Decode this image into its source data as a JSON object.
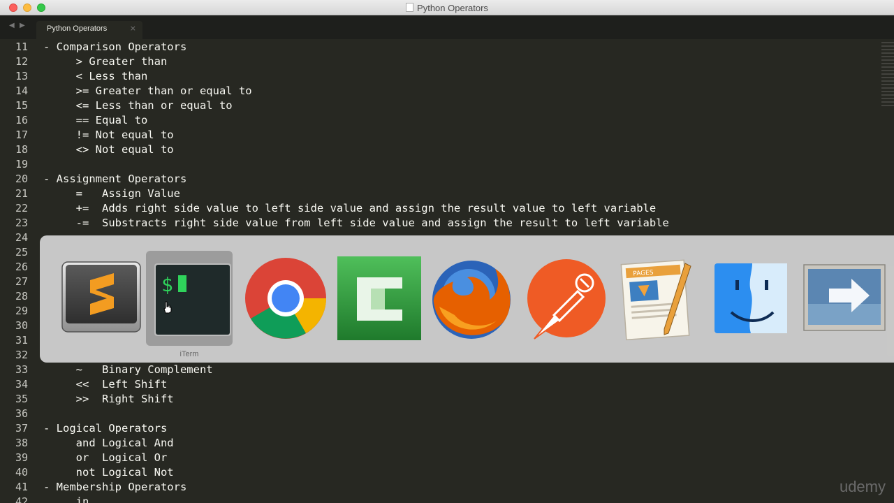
{
  "window": {
    "title": "Python Operators"
  },
  "tabbar": {
    "back_glyph": "◀",
    "forward_glyph": "▶",
    "tab_label": "Python Operators",
    "tab_close": "×"
  },
  "editor": {
    "lines": [
      {
        "num": "11",
        "text": "- Comparison Operators"
      },
      {
        "num": "12",
        "text": "     > Greater than"
      },
      {
        "num": "13",
        "text": "     < Less than"
      },
      {
        "num": "14",
        "text": "     >= Greater than or equal to"
      },
      {
        "num": "15",
        "text": "     <= Less than or equal to"
      },
      {
        "num": "16",
        "text": "     == Equal to"
      },
      {
        "num": "17",
        "text": "     != Not equal to"
      },
      {
        "num": "18",
        "text": "     <> Not equal to"
      },
      {
        "num": "19",
        "text": ""
      },
      {
        "num": "20",
        "text": "- Assignment Operators"
      },
      {
        "num": "21",
        "text": "     =   Assign Value"
      },
      {
        "num": "22",
        "text": "     +=  Adds right side value to left side value and assign the result value to left variable"
      },
      {
        "num": "23",
        "text": "     -=  Substracts right side value from left side value and assign the result to left variable"
      },
      {
        "num": "24",
        "text": ""
      },
      {
        "num": "25",
        "text": ""
      },
      {
        "num": "26",
        "text": ""
      },
      {
        "num": "27",
        "text": ""
      },
      {
        "num": "28",
        "text": ""
      },
      {
        "num": "29",
        "text": ""
      },
      {
        "num": "30",
        "text": ""
      },
      {
        "num": "31",
        "text": ""
      },
      {
        "num": "32",
        "text": ""
      },
      {
        "num": "33",
        "text": "     ~   Binary Complement"
      },
      {
        "num": "34",
        "text": "     <<  Left Shift"
      },
      {
        "num": "35",
        "text": "     >>  Right Shift"
      },
      {
        "num": "36",
        "text": ""
      },
      {
        "num": "37",
        "text": "- Logical Operators"
      },
      {
        "num": "38",
        "text": "     and Logical And"
      },
      {
        "num": "39",
        "text": "     or  Logical Or"
      },
      {
        "num": "40",
        "text": "     not Logical Not"
      },
      {
        "num": "41",
        "text": "- Membership Operators"
      },
      {
        "num": "42",
        "text": "     in"
      }
    ]
  },
  "switcher": {
    "apps": [
      {
        "name": "sublime-text",
        "label": ""
      },
      {
        "name": "iterm",
        "label": "iTerm"
      },
      {
        "name": "chrome",
        "label": ""
      },
      {
        "name": "camtasia",
        "label": ""
      },
      {
        "name": "firefox",
        "label": ""
      },
      {
        "name": "postman",
        "label": ""
      },
      {
        "name": "pages",
        "label": ""
      },
      {
        "name": "finder",
        "label": ""
      },
      {
        "name": "migration-assistant",
        "label": ""
      }
    ],
    "selected_label": "iTerm",
    "terminal_prompt": "$",
    "pages_badge": "PAGES"
  },
  "watermark": "udemy",
  "colors": {
    "editor_bg": "#272822",
    "text": "#f8f8f2",
    "chrome_red": "#db4437",
    "chrome_green": "#0f9d58",
    "chrome_yellow": "#f4b400",
    "chrome_blue": "#4285f4"
  }
}
